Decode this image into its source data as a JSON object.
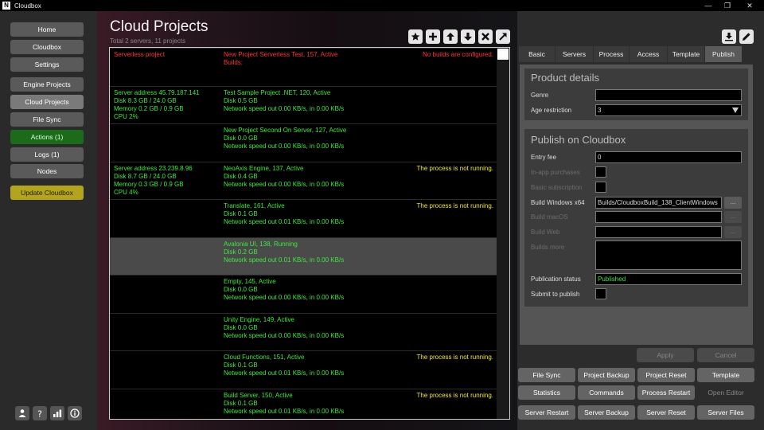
{
  "window": {
    "logo": "N",
    "title": "Cloudbox"
  },
  "sidebar": {
    "items": [
      {
        "label": "Home"
      },
      {
        "label": "Cloudbox"
      },
      {
        "label": "Settings"
      },
      {
        "label": "Engine Projects"
      },
      {
        "label": "Cloud Projects"
      },
      {
        "label": "File Sync"
      },
      {
        "label": "Actions (1)"
      },
      {
        "label": "Logs (1)"
      },
      {
        "label": "Nodes"
      },
      {
        "label": "Update Cloudbox"
      }
    ],
    "bottom_icons": [
      "group-icon",
      "help-icon",
      "stats-icon",
      "info-icon"
    ]
  },
  "header": {
    "title": "Cloud Projects",
    "subtitle": "Total 2 servers, 11 projects",
    "toolbar_icons": [
      "star-icon",
      "add-icon",
      "arrow-up-icon",
      "arrow-down-icon",
      "close-icon",
      "expand-icon"
    ]
  },
  "rows": [
    {
      "server": [
        "Serverless project"
      ],
      "server_color": "red",
      "project": [
        "New Project Serverless Test, 157, Active",
        "Builds:"
      ],
      "project_color": "red",
      "status": "No builds are configured.",
      "status_color": "red"
    },
    {
      "server": [
        "Server address 45.79.187.141",
        "Disk 8.3 GB / 24.0 GB",
        "Memory 0.2 GB / 0.9 GB",
        "CPU 2%"
      ],
      "server_color": "green",
      "project": [
        "Test Sample Project .NET, 120, Active",
        "Disk 0.5 GB",
        "Network speed out 0.00 KB/s, in 0.00 KB/s"
      ],
      "project_color": "green",
      "status": "",
      "status_color": "yellow"
    },
    {
      "server": [],
      "server_color": "green",
      "project": [
        "New Project Second On Server, 127, Active",
        "Disk 0.0 GB",
        "Network speed out 0.00 KB/s, in 0.00 KB/s"
      ],
      "project_color": "green",
      "status": "",
      "status_color": "yellow"
    },
    {
      "server": [
        "Server address 23.239.8.96",
        "Disk 8.7 GB / 24.0 GB",
        "Memory 0.3 GB / 0.9 GB",
        "CPU 4%"
      ],
      "server_color": "green",
      "project": [
        "NeoAxis Engine, 137, Active",
        "Disk 0.4 GB",
        "Network speed out 0.00 KB/s, in 0.00 KB/s"
      ],
      "project_color": "green",
      "status": "The process is not running.",
      "status_color": "yellow"
    },
    {
      "server": [],
      "server_color": "green",
      "project": [
        "Translate, 161, Active",
        "Disk 0.1 GB",
        "Network speed out 0.01 KB/s, in 0.00 KB/s"
      ],
      "project_color": "green",
      "status": "The process is not running.",
      "status_color": "yellow"
    },
    {
      "server": [],
      "server_color": "green",
      "project": [
        "Avalonia UI, 138, Running",
        "Disk 0.2 GB",
        "Network speed out 0.01 KB/s, in 0.00 KB/s"
      ],
      "project_color": "green",
      "status": "",
      "status_color": "yellow",
      "selected": true
    },
    {
      "server": [],
      "server_color": "green",
      "project": [
        "Empty, 145, Active",
        "Disk 0.0 GB",
        "Network speed out 0.00 KB/s, in 0.00 KB/s"
      ],
      "project_color": "green",
      "status": "",
      "status_color": "yellow"
    },
    {
      "server": [],
      "server_color": "green",
      "project": [
        "Unity Engine, 149, Active",
        "Disk 0.0 GB",
        "Network speed out 0.00 KB/s, in 0.00 KB/s"
      ],
      "project_color": "green",
      "status": "",
      "status_color": "yellow"
    },
    {
      "server": [],
      "server_color": "green",
      "project": [
        "Cloud Functions, 151, Active",
        "Disk 0.1 GB",
        "Network speed out 0.01 KB/s, in 0.00 KB/s"
      ],
      "project_color": "green",
      "status": "The process is not running.",
      "status_color": "yellow"
    },
    {
      "server": [],
      "server_color": "green",
      "project": [
        "Build Server, 150, Active",
        "Disk 0.1 GB",
        "Network speed out 0.01 KB/s, in 0.00 KB/s"
      ],
      "project_color": "green",
      "status": "The process is not running.",
      "status_color": "yellow"
    }
  ],
  "right": {
    "top_icons": [
      "download-icon",
      "edit-icon"
    ],
    "tabs": [
      {
        "label": "Basic"
      },
      {
        "label": "Servers"
      },
      {
        "label": "Process"
      },
      {
        "label": "Access"
      },
      {
        "label": "Template"
      },
      {
        "label": "Publish"
      }
    ],
    "product": {
      "title": "Product details",
      "genre_label": "Genre",
      "genre_value": "",
      "age_label": "Age restriction",
      "age_value": "3"
    },
    "publish": {
      "title": "Publish on Cloudbox",
      "entry_fee_label": "Entry fee",
      "entry_fee_value": "0",
      "in_app_label": "In-app purchases",
      "basic_sub_label": "Basic subscription",
      "build_win_label": "Build Windows x64",
      "build_win_value": "Builds/CloudboxBuild_138_ClientWindows",
      "build_mac_label": "Build macOS",
      "build_web_label": "Build Web",
      "builds_more_label": "Builds more",
      "pub_status_label": "Publication status",
      "pub_status_value": "Published",
      "submit_label": "Submit to publish",
      "browse_label": "..."
    },
    "apply_label": "Apply",
    "cancel_label": "Cancel",
    "actions": [
      {
        "label": "File Sync"
      },
      {
        "label": "Project Backup"
      },
      {
        "label": "Project Reset"
      },
      {
        "label": "Template"
      },
      {
        "label": "Statistics"
      },
      {
        "label": "Commands"
      },
      {
        "label": "Process Restart"
      },
      {
        "label": "Open Editor"
      },
      {
        "label": "Server Restart"
      },
      {
        "label": "Server Backup"
      },
      {
        "label": "Server Reset"
      },
      {
        "label": "Server Files"
      }
    ]
  }
}
